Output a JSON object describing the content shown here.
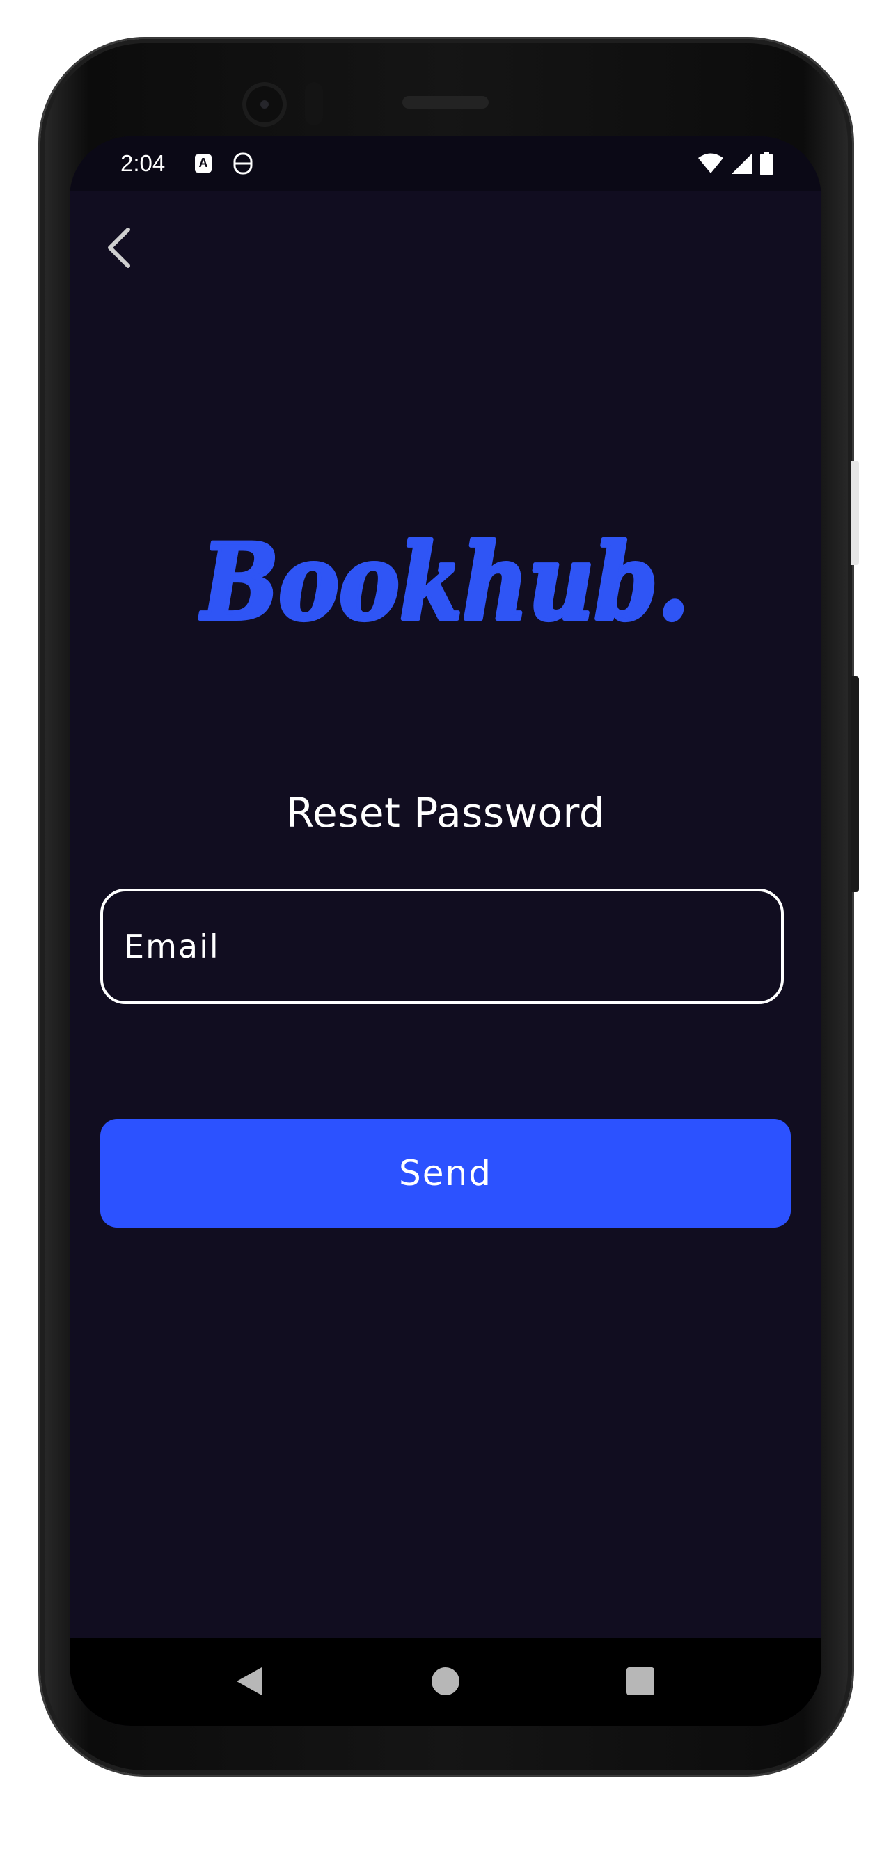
{
  "status_bar": {
    "time": "2:04",
    "notification_icons": [
      "a-icon",
      "s-icon"
    ],
    "system_icons": [
      "wifi-icon",
      "cellular-signal-icon",
      "battery-icon"
    ]
  },
  "header": {
    "back_icon": "chevron-left-icon"
  },
  "logo": {
    "text": "Bookhub."
  },
  "main": {
    "title": "Reset Password",
    "email_placeholder": "Email",
    "email_value": "",
    "send_label": "Send"
  },
  "nav_bar": {
    "items": [
      "back-triangle-icon",
      "home-circle-icon",
      "recents-square-icon"
    ]
  },
  "colors": {
    "background": "#110d20",
    "accent": "#2c52ff",
    "logo": "#2f55f5",
    "text": "#ffffff"
  }
}
